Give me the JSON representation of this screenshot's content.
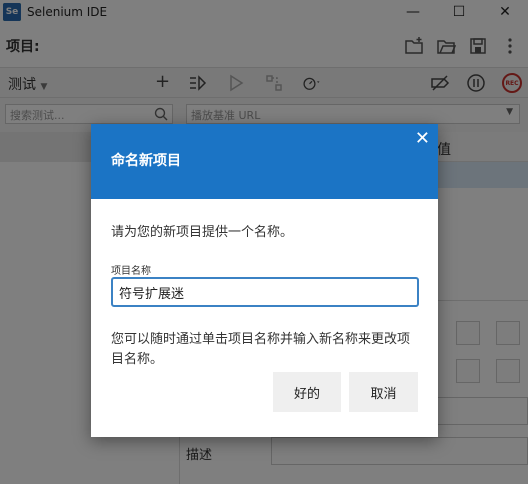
{
  "window": {
    "app_title": "Selenium IDE",
    "logo_text": "Se",
    "minimize_glyph": "—",
    "maximize_glyph": "☐",
    "close_glyph": "✕"
  },
  "project": {
    "label": "项目:"
  },
  "toolbar": {
    "tests_dropdown": "测试",
    "add_glyph": "+",
    "rec_label": "REC"
  },
  "filters": {
    "search_placeholder": "搜索测试...",
    "base_url_placeholder": "播放基准 URL"
  },
  "table": {
    "value_header": "值"
  },
  "command_panel": {
    "description_label": "描述"
  },
  "dialog": {
    "title": "命名新项目",
    "close_glyph": "✕",
    "prompt": "请为您的新项目提供一个名称。",
    "field_label": "项目名称",
    "field_value": "符号扩展迷",
    "help_text": "您可以随时通过单击项目名称并输入新名称来更改项目名称。",
    "ok_label": "好的",
    "cancel_label": "取消"
  },
  "colors": {
    "dialog_header": "#1b74c5",
    "input_focus": "#3b82c4",
    "rec_red": "#c9302c"
  }
}
